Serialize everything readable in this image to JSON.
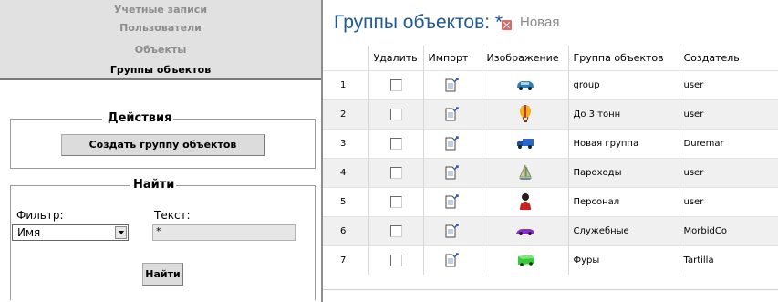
{
  "nav": {
    "items": [
      {
        "label": "Учетные записи",
        "active": false
      },
      {
        "label": "Пользователи",
        "active": false
      },
      {
        "label": "Объекты",
        "active": false
      },
      {
        "label": "Группы объектов",
        "active": true
      }
    ]
  },
  "actions": {
    "legend": "Действия",
    "create_label": "Создать группу объектов"
  },
  "find": {
    "legend": "Найти",
    "filter_label": "Фильтр:",
    "filter_value": "Имя",
    "text_label": "Текст:",
    "text_value": "*",
    "find_label": "Найти"
  },
  "header": {
    "title": "Группы объектов: *",
    "tab_new": "Новая"
  },
  "table": {
    "columns": [
      "",
      "Удалить",
      "Импорт",
      "Изображение",
      "Группа объектов",
      "Создатель"
    ],
    "rows": [
      {
        "num": "1",
        "name": "group",
        "creator": "user",
        "icon": "blue-car-icon"
      },
      {
        "num": "2",
        "name": "До 3 тонн",
        "creator": "user",
        "icon": "hot-air-balloon-icon"
      },
      {
        "num": "3",
        "name": "Новая группа",
        "creator": "Duremar",
        "icon": "blue-truck-icon"
      },
      {
        "num": "4",
        "name": "Пароходы",
        "creator": "user",
        "icon": "sailboat-icon"
      },
      {
        "num": "5",
        "name": "Персонал",
        "creator": "user",
        "icon": "person-icon"
      },
      {
        "num": "6",
        "name": "Служебные",
        "creator": "MorbidCo",
        "icon": "purple-car-icon"
      },
      {
        "num": "7",
        "name": "Фуры",
        "creator": "Tartilla",
        "icon": "green-truck-icon"
      }
    ]
  },
  "colors": {
    "title": "#1f5a96",
    "nav_bg": "#e1e1e1",
    "close": "#d76a6a"
  }
}
